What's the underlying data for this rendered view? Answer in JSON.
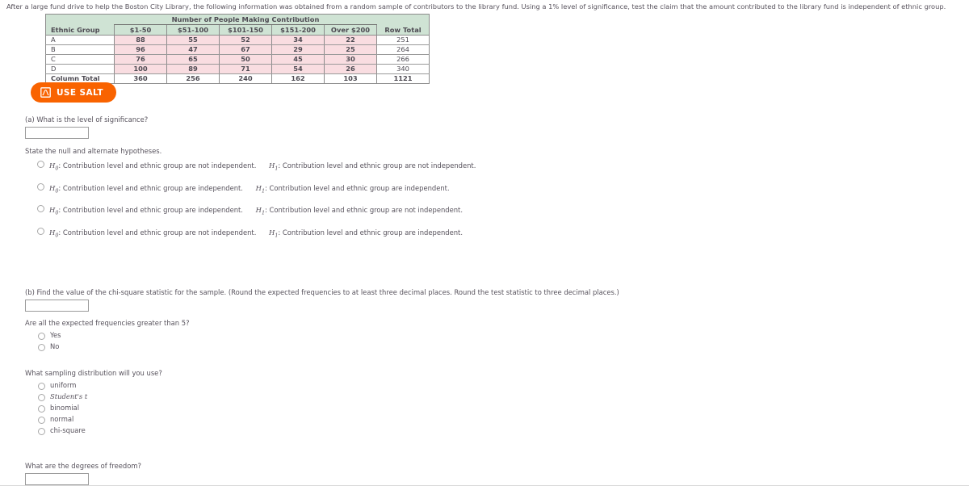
{
  "intro": {
    "text": "After a large fund drive to help the Boston City Library, the following information was obtained from a random sample of contributors to the library fund. Using a 1% level of significance, test the claim that the amount contributed to the library fund is independent of ethnic group."
  },
  "table": {
    "group_header": "Number of People Making Contribution",
    "first_col_header": "Ethnic Group",
    "column_headers": [
      "$1-50",
      "$51-100",
      "$101-150",
      "$151-200",
      "Over $200"
    ],
    "row_total_header": "Row Total",
    "rows": [
      {
        "label": "A",
        "values": [
          "88",
          "55",
          "52",
          "34",
          "22"
        ],
        "row_total": "251"
      },
      {
        "label": "B",
        "values": [
          "96",
          "47",
          "67",
          "29",
          "25"
        ],
        "row_total": "264"
      },
      {
        "label": "C",
        "values": [
          "76",
          "65",
          "50",
          "45",
          "30"
        ],
        "row_total": "266"
      },
      {
        "label": "D",
        "values": [
          "100",
          "89",
          "71",
          "54",
          "26"
        ],
        "row_total": "340"
      }
    ],
    "total_row": {
      "label": "Column Total",
      "values": [
        "360",
        "256",
        "240",
        "162",
        "103"
      ],
      "row_total": "1121"
    },
    "colors": {
      "header_bg": "#cfe3d4",
      "data_bg": "#f9dde1",
      "total_bg": "#ffffff",
      "border": "#8c8c8c"
    }
  },
  "salt_button": {
    "label": "USE SALT",
    "icon": "distribution-curve-icon",
    "bg_color": "#f96300",
    "text_color": "#ffffff"
  },
  "question_a": {
    "label": "(a) What is the level of significance?",
    "input_value": ""
  },
  "hypotheses": {
    "prompt": "State the null and alternate hypotheses.",
    "options": [
      {
        "h0_prefix": "H",
        "h0_sub": "0",
        "h0_text": ": Contribution level and ethnic group are not independent.",
        "h1_prefix": "H",
        "h1_sub": "1",
        "h1_text": ": Contribution level and ethnic group are not independent."
      },
      {
        "h0_prefix": "H",
        "h0_sub": "0",
        "h0_text": ": Contribution level and ethnic group are independent.",
        "h1_prefix": "H",
        "h1_sub": "1",
        "h1_text": ": Contribution level and ethnic group are independent."
      },
      {
        "h0_prefix": "H",
        "h0_sub": "0",
        "h0_text": ": Contribution level and ethnic group are independent.",
        "h1_prefix": "H",
        "h1_sub": "1",
        "h1_text": ": Contribution level and ethnic group are not independent."
      },
      {
        "h0_prefix": "H",
        "h0_sub": "0",
        "h0_text": ": Contribution level and ethnic group are not independent.",
        "h1_prefix": "H",
        "h1_sub": "1",
        "h1_text": ": Contribution level and ethnic group are independent."
      }
    ]
  },
  "question_b": {
    "label": "(b) Find the value of the chi-square statistic for the sample. (Round the expected frequencies to at least three decimal places. Round the test statistic to three decimal places.)",
    "input_value": ""
  },
  "expected_frequencies": {
    "prompt": "Are all the expected frequencies greater than 5?",
    "options": [
      "Yes",
      "No"
    ]
  },
  "sampling_distribution": {
    "prompt": "What sampling distribution will you use?",
    "options": [
      "uniform",
      "Student's t",
      "binomial",
      "normal",
      "chi-square"
    ],
    "italic_option_index": 1
  },
  "degrees_of_freedom": {
    "label": "What are the degrees of freedom?",
    "input_value": ""
  }
}
